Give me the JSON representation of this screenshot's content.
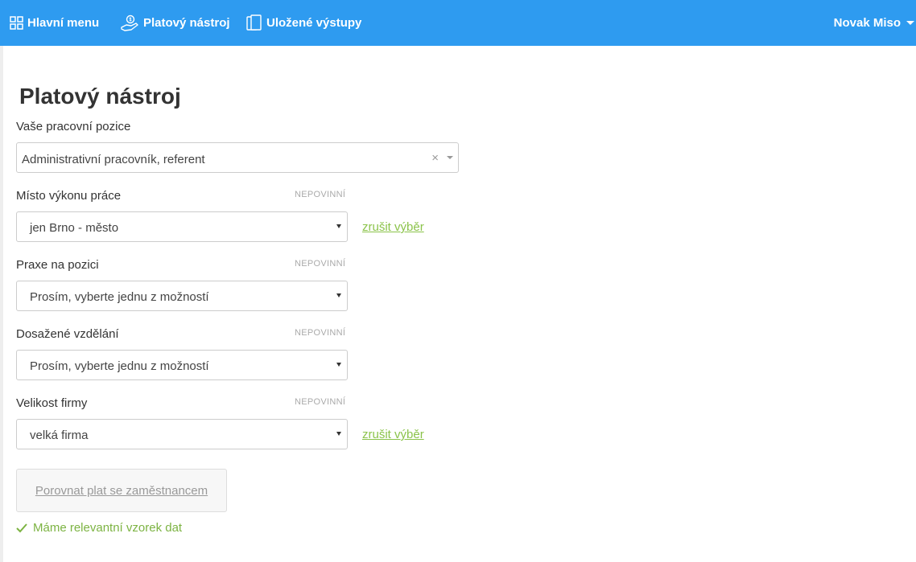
{
  "header": {
    "nav": [
      {
        "label": "Hlavní menu",
        "icon": "grid-icon"
      },
      {
        "label": "Platový nástroj",
        "icon": "hand-money-icon"
      },
      {
        "label": "Uložené výstupy",
        "icon": "documents-icon"
      }
    ],
    "user": "Novak Miso",
    "accent_color": "#2e9bf0"
  },
  "page": {
    "title": "Platový nástroj"
  },
  "form": {
    "position": {
      "label": "Vaše pracovní pozice",
      "value": "Administrativní pracovník, referent",
      "clear_glyph": "×"
    },
    "location": {
      "label": "Místo výkonu práce",
      "optional": "NEPOVINNÍ",
      "value": "jen Brno - město",
      "clear_label": "zrušit výběr"
    },
    "experience": {
      "label": "Praxe na pozici",
      "optional": "NEPOVINNÍ",
      "value": "Prosím, vyberte jednu z možností"
    },
    "education": {
      "label": "Dosažené vzdělání",
      "optional": "NEPOVINNÍ",
      "value": "Prosím, vyberte jednu z možností"
    },
    "company_size": {
      "label": "Velikost firmy",
      "optional": "NEPOVINNÍ",
      "value": "velká firma",
      "clear_label": "zrušit výběr"
    },
    "compare_button": "Porovnat plat se zaměstnancem",
    "status": "Máme relevantní vzorek dat",
    "status_color": "#7cb342",
    "link_color": "#8bc34a"
  }
}
